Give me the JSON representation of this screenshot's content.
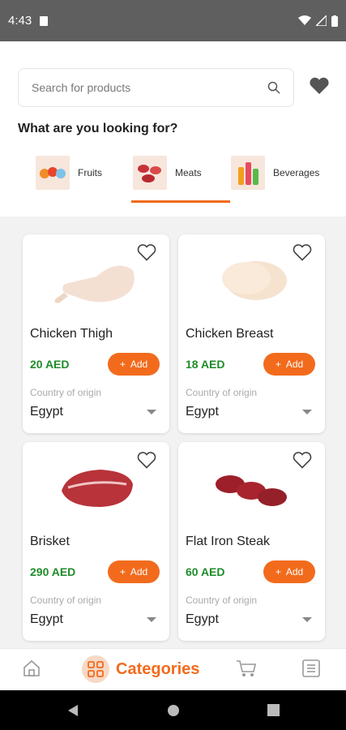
{
  "status_bar": {
    "time": "4:43"
  },
  "search": {
    "placeholder": "Search for products"
  },
  "section_title": "What are you looking for?",
  "categories": [
    {
      "label": "Fruits",
      "active": false
    },
    {
      "label": "Meats",
      "active": true
    },
    {
      "label": "Beverages",
      "active": false
    }
  ],
  "products": [
    {
      "name": "Chicken Thigh",
      "price": "20 AED",
      "add_label": "Add",
      "origin_label": "Country of origin",
      "origin_value": "Egypt"
    },
    {
      "name": "Chicken Breast",
      "price": "18 AED",
      "add_label": "Add",
      "origin_label": "Country of origin",
      "origin_value": "Egypt"
    },
    {
      "name": "Brisket",
      "price": "290 AED",
      "add_label": "Add",
      "origin_label": "Country of origin",
      "origin_value": "Egypt"
    },
    {
      "name": "Flat Iron Steak",
      "price": "60 AED",
      "add_label": "Add",
      "origin_label": "Country of origin",
      "origin_value": "Egypt"
    }
  ],
  "bottom_nav": {
    "active_label": "Categories"
  },
  "colors": {
    "accent": "#f26b1d",
    "price": "#1f8c2a"
  }
}
